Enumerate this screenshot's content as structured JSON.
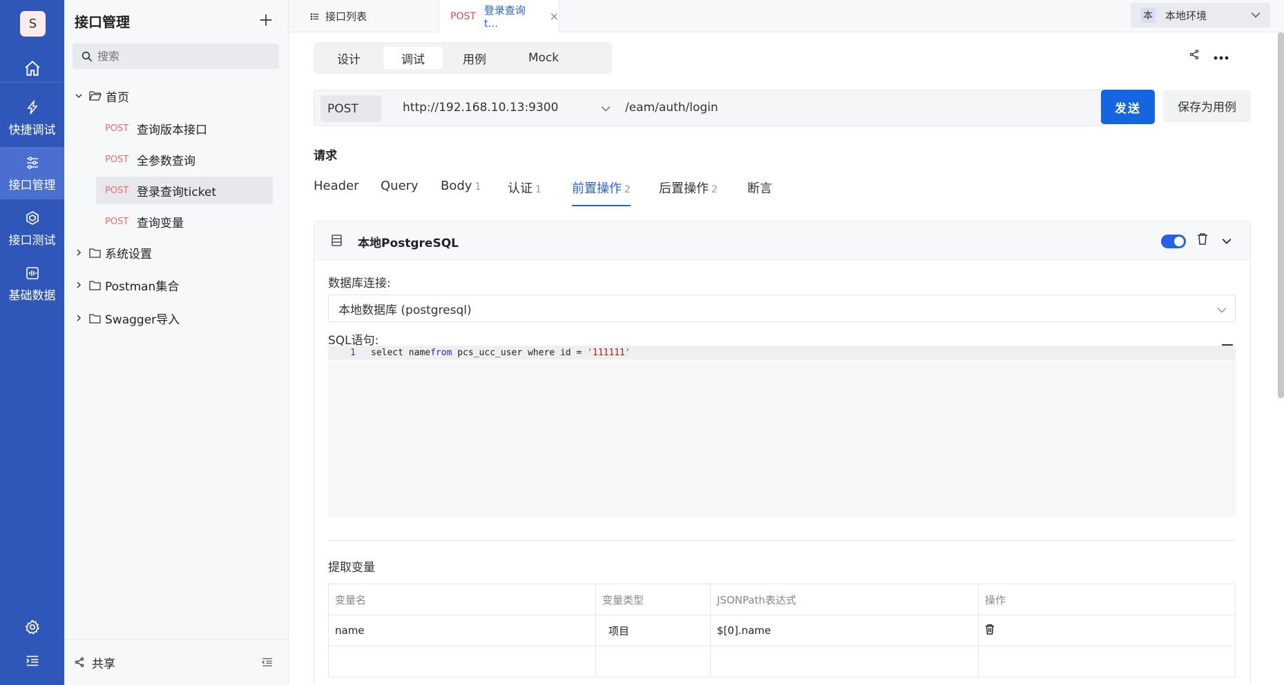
{
  "rail": {
    "avatar": "S",
    "items": [
      {
        "label": "快捷调试",
        "icon": "lightning-icon"
      },
      {
        "label": "接口管理",
        "icon": "sliders-icon"
      },
      {
        "label": "接口测试",
        "icon": "cube-icon"
      },
      {
        "label": "基础数据",
        "icon": "waveform-icon"
      }
    ]
  },
  "tree": {
    "title": "接口管理",
    "search_placeholder": "搜索",
    "home": "首页",
    "leaves": [
      {
        "method": "POST",
        "label": "查询版本接口"
      },
      {
        "method": "POST",
        "label": "全参数查询"
      },
      {
        "method": "POST",
        "label": "登录查询ticket"
      },
      {
        "method": "POST",
        "label": "查询变量"
      }
    ],
    "folders": [
      "系统设置",
      "Postman集合",
      "Swagger导入"
    ],
    "share": "共享"
  },
  "tabs": {
    "list": "接口列表",
    "active_method": "POST",
    "active_label": "登录查询t...",
    "close": "×"
  },
  "env": {
    "badge": "本",
    "label": "本地环境"
  },
  "seg": [
    "设计",
    "调试",
    "用例",
    "Mock"
  ],
  "url": {
    "method": "POST",
    "host": "http://192.168.10.13:9300",
    "path": "/eam/auth/login",
    "send": "发送",
    "save_as": "保存为用例"
  },
  "request": {
    "title": "请求",
    "tabs": [
      {
        "label": "Header",
        "count": ""
      },
      {
        "label": "Query",
        "count": ""
      },
      {
        "label": "Body",
        "count": "1"
      },
      {
        "label": "认证",
        "count": "1"
      },
      {
        "label": "前置操作",
        "count": "2"
      },
      {
        "label": "后置操作",
        "count": "2"
      },
      {
        "label": "断言",
        "count": ""
      }
    ]
  },
  "card": {
    "title": "本地PostgreSQL",
    "enabled": true,
    "db_label": "数据库连接:",
    "db_value": "本地数据库 (postgresql)",
    "sql_label": "SQL语句:",
    "sql_line_no": "1",
    "sql_a": "select name ",
    "sql_kw": "from",
    "sql_b": " pcs_ucc_user where id = ",
    "sql_str": "'111111'",
    "extract_title": "提取变量",
    "table": {
      "headers": [
        "变量名",
        "变量类型",
        "JSONPath表达式",
        "操作"
      ],
      "rows": [
        {
          "name": "name",
          "type": "项目",
          "path": "$[0].name"
        }
      ]
    }
  }
}
